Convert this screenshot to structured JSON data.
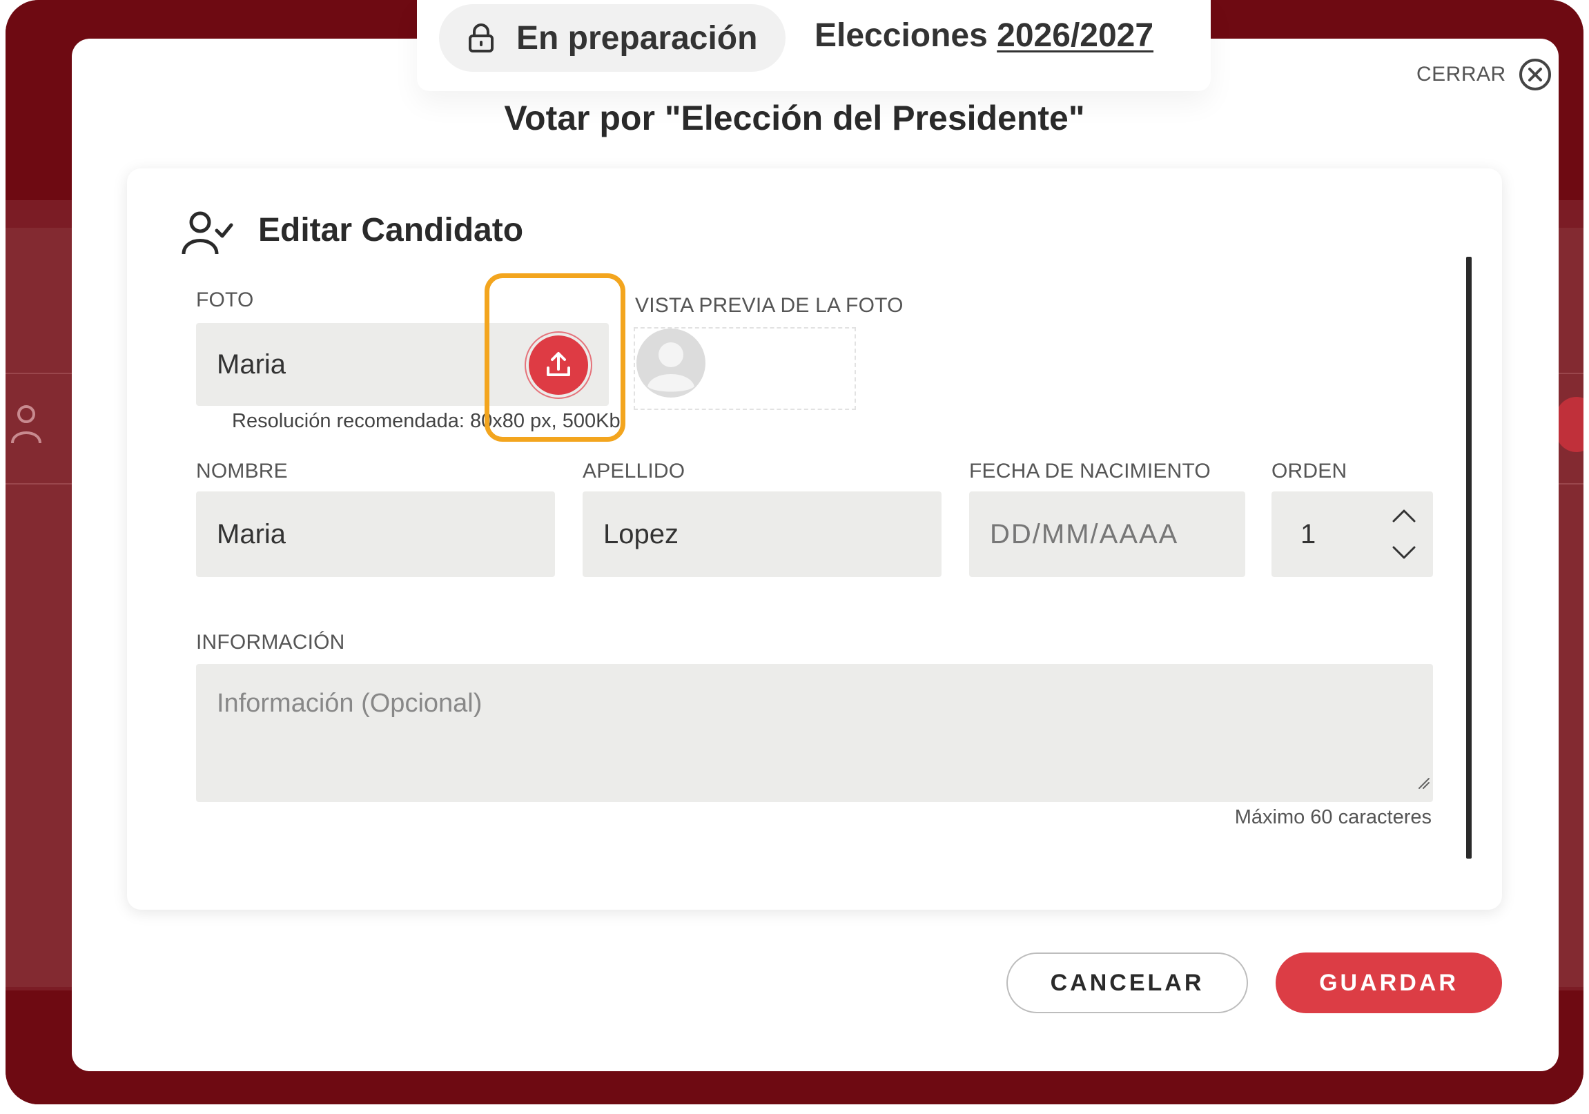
{
  "header": {
    "status_label": "En preparación",
    "elections_prefix": "Elecciones",
    "elections_year": "2026/2027",
    "close_label": "CERRAR"
  },
  "page_title": "Votar por \"Elección del Presidente\"",
  "form": {
    "title": "Editar Candidato",
    "photo": {
      "label": "FOTO",
      "value": "Maria",
      "hint": "Resolución recomendada: 80x80 px, 500Kb",
      "preview_label": "VISTA PREVIA DE LA FOTO"
    },
    "first_name": {
      "label": "NOMBRE",
      "value": "Maria"
    },
    "last_name": {
      "label": "APELLIDO",
      "value": "Lopez"
    },
    "birth_date": {
      "label": "FECHA DE NACIMIENTO",
      "placeholder": "DD/MM/AAAA"
    },
    "order": {
      "label": "ORDEN",
      "value": "1"
    },
    "info": {
      "label": "INFORMACIÓN",
      "placeholder": "Información (Opcional)",
      "max_hint": "Máximo 60 caracteres"
    }
  },
  "actions": {
    "cancel_label": "CANCELAR",
    "save_label": "GUARDAR"
  },
  "colors": {
    "brand_dark": "#6e0a12",
    "accent_red": "#dc3d45",
    "highlight": "#f3a51e",
    "field_bg": "#ececea"
  },
  "icons": [
    "lock-icon",
    "close-circle-icon",
    "user-check-icon",
    "upload-icon",
    "avatar-placeholder-icon",
    "chevron-up-icon",
    "chevron-down-icon",
    "resize-handle-icon"
  ]
}
